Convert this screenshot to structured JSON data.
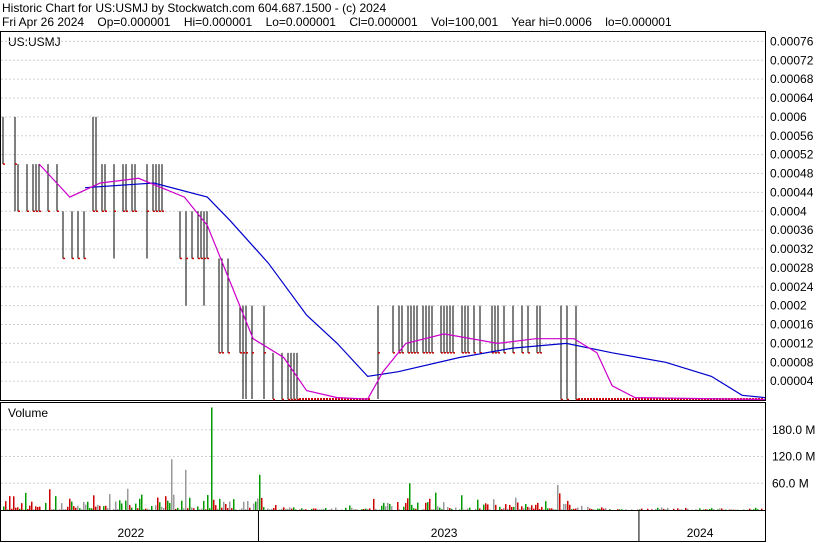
{
  "header": {
    "title": "Historic Chart for US:USMJ by Stockwatch.com 604.687.1500 - (c) 2024",
    "date": "Fri Apr 26 2024",
    "open": "Op=0.000001",
    "high": "Hi=0.000001",
    "low": "Lo=0.000001",
    "close": "Cl=0.000001",
    "volume": "Vol=100,001",
    "year_high": "Year hi=0.0006",
    "year_low": "lo=0.000001"
  },
  "chart_data": [
    {
      "type": "bar",
      "title": "US:USMJ",
      "ylim": [
        0,
        0.00078
      ],
      "y_ticks": [
        "0.00076",
        "0.00072",
        "0.00068",
        "0.00064",
        "0.0006",
        "0.00056",
        "0.00052",
        "0.00048",
        "0.00044",
        "0.0004",
        "0.00036",
        "0.00032",
        "0.00028",
        "0.00024",
        "0.0002",
        "0.00016",
        "0.00012",
        "0.00008",
        "0.00004"
      ],
      "x_ticks": [
        "2022",
        "2023",
        "2024"
      ],
      "x_range": [
        "2021-09",
        "2024-04"
      ],
      "price_segments": [
        {
          "x": 0.0,
          "hi": 0.0006,
          "lo": 0.0005
        },
        {
          "x": 0.02,
          "hi": 0.0005,
          "lo": 0.0004
        },
        {
          "x": 0.08,
          "hi": 0.0004,
          "lo": 0.0003
        },
        {
          "x": 0.11,
          "hi": 0.0006,
          "lo": 0.0004
        },
        {
          "x": 0.13,
          "hi": 0.0005,
          "lo": 0.0004
        },
        {
          "x": 0.21,
          "hi": 0.0005,
          "lo": 0.0004
        },
        {
          "x": 0.23,
          "hi": 0.0004,
          "lo": 0.0003
        },
        {
          "x": 0.28,
          "hi": 0.0003,
          "lo": 0.0001
        },
        {
          "x": 0.31,
          "hi": 0.0002,
          "lo": 0.0001
        },
        {
          "x": 0.345,
          "hi": 0.0001,
          "lo": 1e-06
        },
        {
          "x": 0.39,
          "hi": 1e-06,
          "lo": 1e-06
        },
        {
          "x": 0.485,
          "hi": 0.0002,
          "lo": 0.0001
        },
        {
          "x": 0.73,
          "hi": 0.0002,
          "lo": 1e-06
        },
        {
          "x": 0.755,
          "hi": 1e-06,
          "lo": 1e-06
        },
        {
          "x": 1.0,
          "hi": 1e-06,
          "lo": 1e-06
        }
      ],
      "series": [
        {
          "name": "",
          "color": "#0000cc",
          "points": [
            [
              0.11,
              0.00045
            ],
            [
              0.2,
              0.00046
            ],
            [
              0.27,
              0.00043
            ],
            [
              0.3,
              0.00038
            ],
            [
              0.35,
              0.00029
            ],
            [
              0.4,
              0.00018
            ],
            [
              0.44,
              0.00012
            ],
            [
              0.48,
              5e-05
            ],
            [
              0.52,
              6e-05
            ],
            [
              0.6,
              9e-05
            ],
            [
              0.67,
              0.00011
            ],
            [
              0.74,
              0.00012
            ],
            [
              0.8,
              0.0001
            ],
            [
              0.87,
              8e-05
            ],
            [
              0.93,
              5e-05
            ],
            [
              0.97,
              1e-05
            ],
            [
              1.0,
              5e-06
            ]
          ]
        },
        {
          "name": "",
          "color": "#cc00cc",
          "points": [
            [
              0.05,
              0.0005
            ],
            [
              0.09,
              0.00043
            ],
            [
              0.13,
              0.00046
            ],
            [
              0.18,
              0.00047
            ],
            [
              0.24,
              0.00043
            ],
            [
              0.27,
              0.00037
            ],
            [
              0.3,
              0.00025
            ],
            [
              0.33,
              0.00013
            ],
            [
              0.37,
              9e-05
            ],
            [
              0.4,
              2e-05
            ],
            [
              0.44,
              5e-06
            ],
            [
              0.48,
              2e-06
            ],
            [
              0.5,
              6e-05
            ],
            [
              0.53,
              0.00012
            ],
            [
              0.58,
              0.00014
            ],
            [
              0.65,
              0.00012
            ],
            [
              0.7,
              0.00013
            ],
            [
              0.75,
              0.00013
            ],
            [
              0.78,
              0.0001
            ],
            [
              0.8,
              3e-05
            ],
            [
              0.83,
              5e-06
            ],
            [
              1.0,
              1e-06
            ]
          ]
        }
      ]
    },
    {
      "type": "bar",
      "title": "Volume",
      "ylim": [
        0,
        240
      ],
      "y_ticks": [
        "180.0 M",
        "120.0 M",
        "60.0 M"
      ],
      "y_tick_values": [
        180,
        120,
        60
      ],
      "activity": [
        {
          "x0": 0.0,
          "x1": 0.345,
          "avg": 22,
          "spike_x": 0.275,
          "spike_v": 230
        },
        {
          "x0": 0.345,
          "x1": 0.485,
          "avg": 3
        },
        {
          "x0": 0.485,
          "x1": 0.76,
          "avg": 14
        },
        {
          "x0": 0.76,
          "x1": 1.0,
          "avg": 3
        }
      ]
    }
  ]
}
